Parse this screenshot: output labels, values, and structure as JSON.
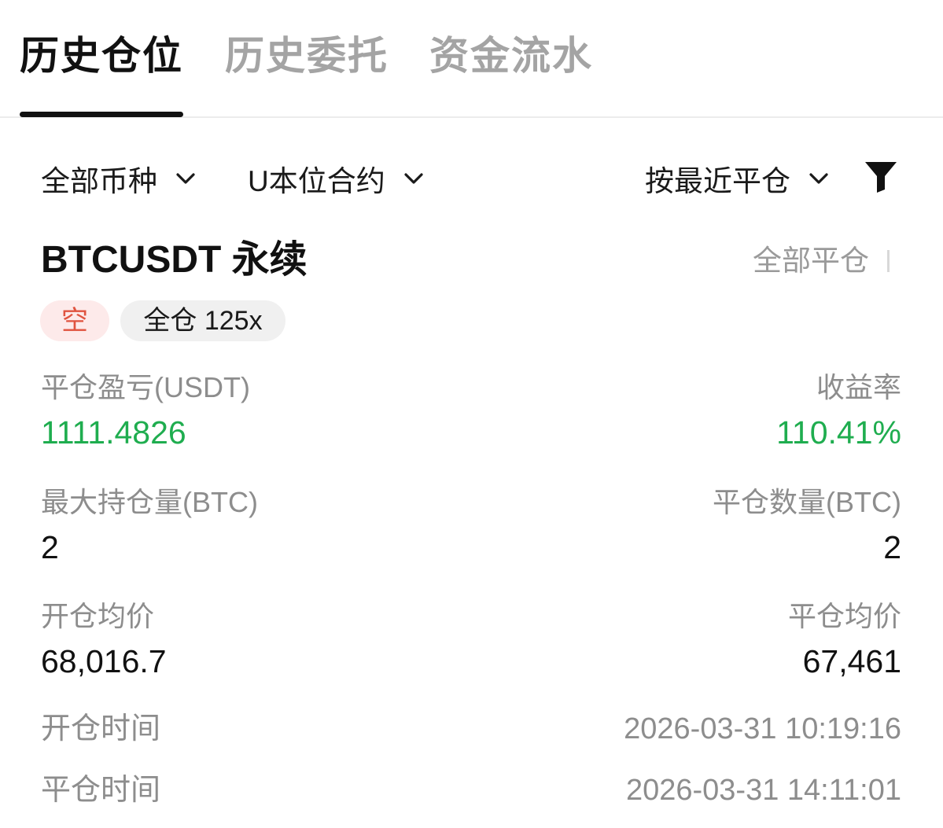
{
  "tabs": {
    "positions": "历史仓位",
    "orders": "历史委托",
    "funds": "资金流水"
  },
  "filters": {
    "coin": "全部币种",
    "contract": "U本位合约",
    "sort": "按最近平仓"
  },
  "icons": {
    "chevron": "chevron-down-icon",
    "filter": "funnel-filter-icon"
  },
  "position": {
    "symbol": "BTCUSDT 永续",
    "close_type": "全部平仓",
    "side_tag": "空",
    "margin_tag": "全仓 125x",
    "pnl_label": "平仓盈亏(USDT)",
    "pnl_value": "1111.4826",
    "roi_label": "收益率",
    "roi_value": "110.41%",
    "max_size_label": "最大持仓量(BTC)",
    "max_size_value": "2",
    "close_qty_label": "平仓数量(BTC)",
    "close_qty_value": "2",
    "open_price_label": "开仓均价",
    "open_price_value": "68,016.7",
    "close_price_label": "平仓均价",
    "close_price_value": "67,461",
    "open_time_label": "开仓时间",
    "open_time_value": "2026-03-31 10:19:16",
    "close_time_label": "平仓时间",
    "close_time_value": "2026-03-31 14:11:01"
  },
  "colors": {
    "profit_green": "#1fad4f",
    "short_red": "#e0533f",
    "short_bg": "#fdeaea"
  }
}
